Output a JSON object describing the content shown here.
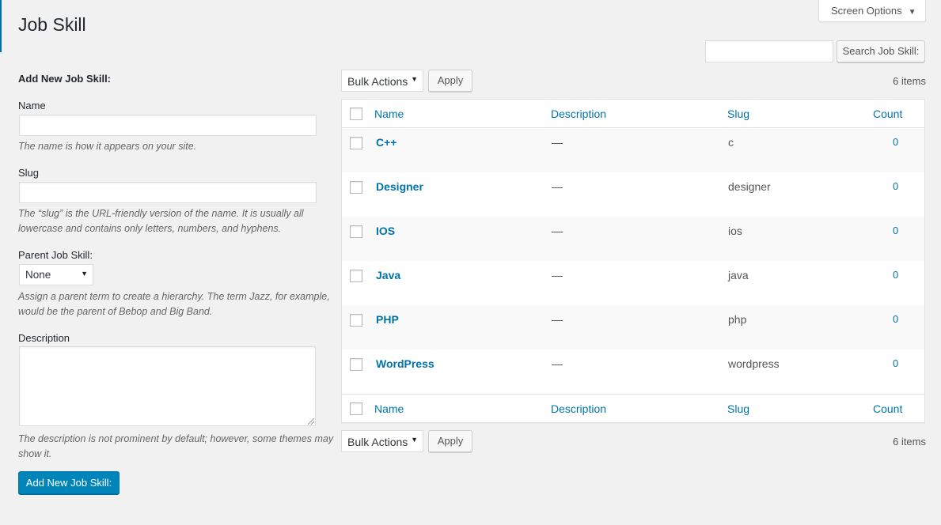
{
  "page": {
    "title": "Job Skill",
    "screen_options_label": "Screen Options"
  },
  "search": {
    "button_label": "Search Job Skill:",
    "value": ""
  },
  "form": {
    "heading": "Add New Job Skill:",
    "name_label": "Name",
    "name_value": "",
    "name_help": "The name is how it appears on your site.",
    "slug_label": "Slug",
    "slug_value": "",
    "slug_help": "The “slug” is the URL-friendly version of the name. It is usually all lowercase and contains only letters, numbers, and hyphens.",
    "parent_label": "Parent Job Skill:",
    "parent_selected": "None",
    "parent_help": "Assign a parent term to create a hierarchy. The term Jazz, for example, would be the parent of Bebop and Big Band.",
    "description_label": "Description",
    "description_value": "",
    "description_help": "The description is not prominent by default; however, some themes may show it.",
    "submit_label": "Add New Job Skill:"
  },
  "list": {
    "bulk_actions_label": "Bulk Actions",
    "apply_label": "Apply",
    "items_count": "6 items",
    "columns": {
      "name": "Name",
      "description": "Description",
      "slug": "Slug",
      "count": "Count"
    },
    "rows": [
      {
        "name": "C++",
        "description": "—",
        "slug": "c",
        "count": "0"
      },
      {
        "name": "Designer",
        "description": "—",
        "slug": "designer",
        "count": "0"
      },
      {
        "name": "IOS",
        "description": "—",
        "slug": "ios",
        "count": "0"
      },
      {
        "name": "Java",
        "description": "—",
        "slug": "java",
        "count": "0"
      },
      {
        "name": "PHP",
        "description": "—",
        "slug": "php",
        "count": "0"
      },
      {
        "name": "WordPress",
        "description": "—",
        "slug": "wordpress",
        "count": "0"
      }
    ]
  },
  "colors": {
    "accent": "#0073aa",
    "primary_button": "#0085ba",
    "background": "#f1f1f1"
  }
}
